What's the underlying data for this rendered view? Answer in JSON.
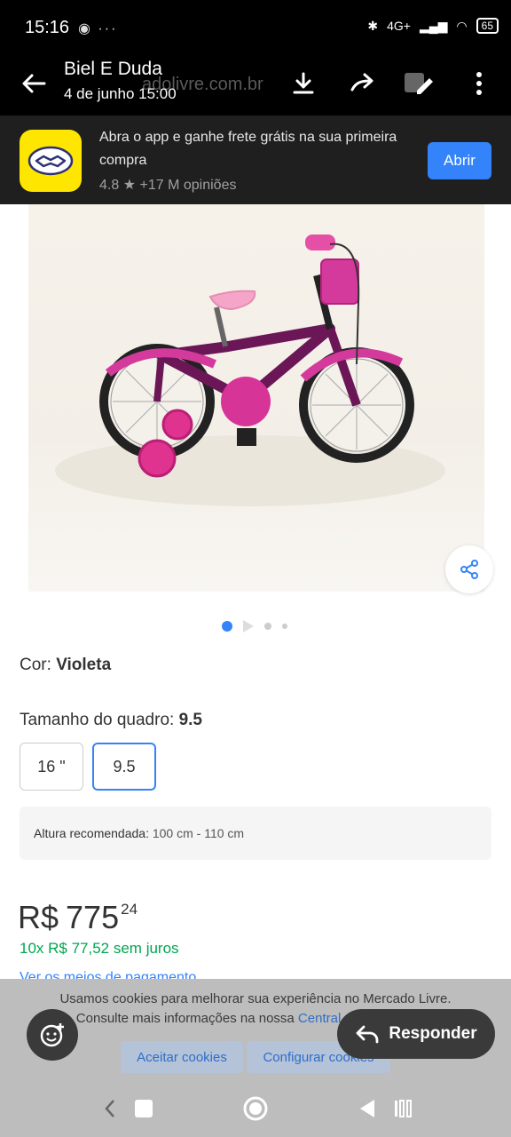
{
  "status_bar": {
    "time": "15:16",
    "left_icons": "◉ ···",
    "network": "4G+",
    "battery": "65"
  },
  "viewer": {
    "title": "Biel E Duda",
    "subtitle": "4 de junho 15:00",
    "ghost_url": "adolivre.com.br",
    "icons": [
      "back-arrow-icon",
      "download-icon",
      "forward-icon",
      "edit-icon",
      "more-vertical-icon"
    ]
  },
  "app_banner": {
    "text": "Abra o app e ganhe frete grátis na sua primeira compra",
    "rating": "4.8",
    "reviews": "+17 M opiniões",
    "open_label": "Abrir",
    "brand_color": "#ffe600",
    "accent_color": "#3483fa"
  },
  "product": {
    "image_alt": "bicicleta infantil violeta",
    "carousel_count": 4,
    "carousel_active": 1,
    "color_label": "Cor: ",
    "color_value": "Violeta",
    "size_label": "Tamanho do quadro: ",
    "size_value": "9.5",
    "sizes": [
      "16 \"",
      "9.5"
    ],
    "selected_size": "9.5",
    "height_label": "Altura recomendada: ",
    "height_value": "100 cm - 110 cm",
    "price_currency": "R$",
    "price_int": "775",
    "price_cents": "24",
    "installments": "10x R$ 77,52 sem juros",
    "payment_link": "Ver os meios de pagamento",
    "installments_color": "#00a650"
  },
  "cookie": {
    "line1": "Usamos cookies para melhorar sua experiência no Mercado Livre.",
    "line2_prefix": "Consulte mais informações na nossa ",
    "line2_link": "Central de privacidade",
    "line2_suffix": ".",
    "accept": "Aceitar cookies",
    "configure": "Configurar cookies"
  },
  "actions": {
    "reply": "Responder"
  }
}
